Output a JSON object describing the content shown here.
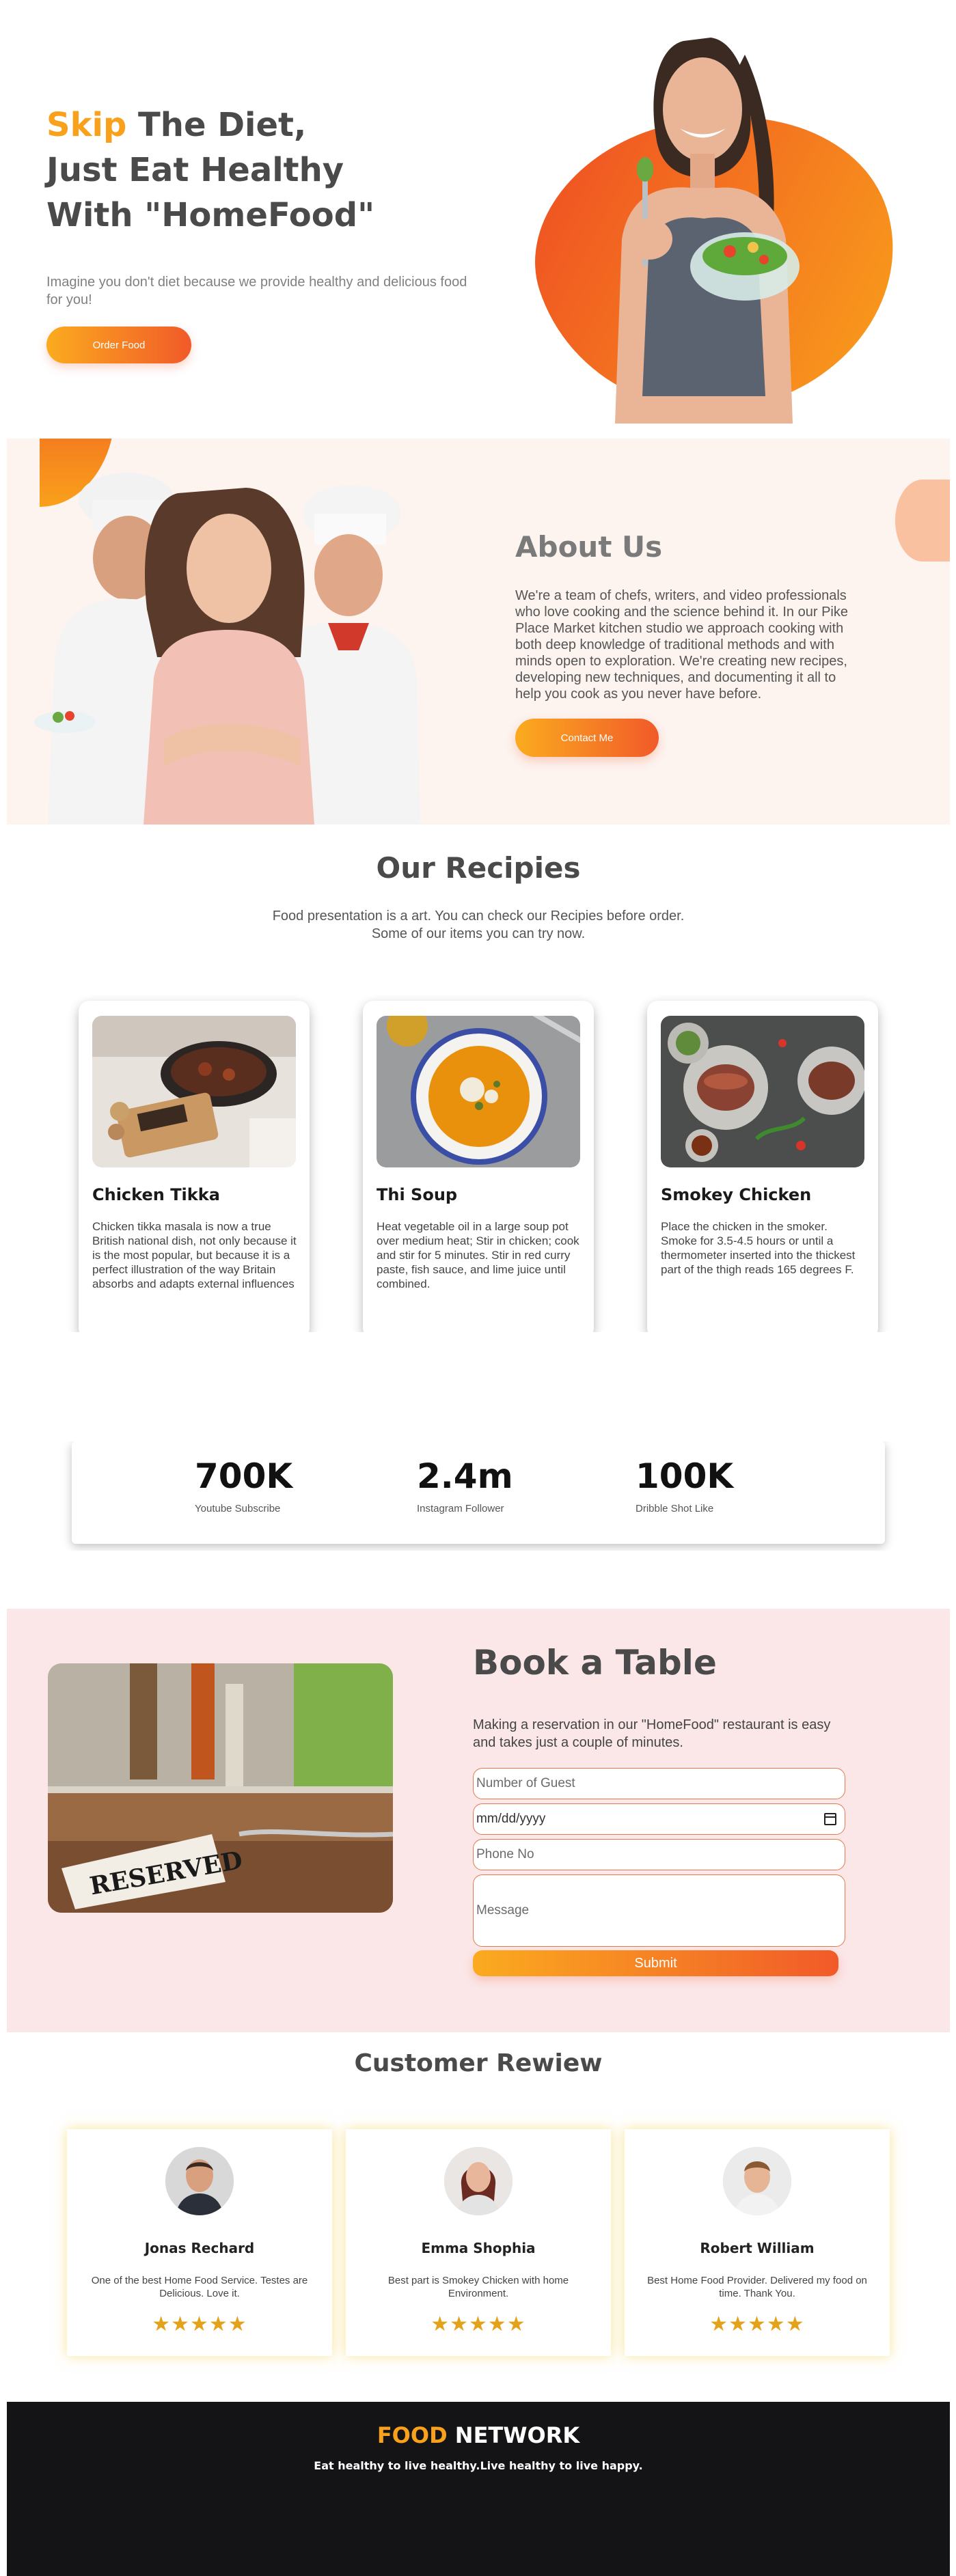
{
  "hero": {
    "title_accent": "Skip",
    "title_rest_1": " The Diet,",
    "title_line_2": "Just Eat Healthy",
    "title_line_3": "With \"HomeFood\"",
    "subtitle": "Imagine you don't diet because we provide healthy and delicious food for you!",
    "cta_label": "Order Food"
  },
  "about": {
    "title": "About Us",
    "text": "We're a team of chefs, writers, and video professionals who love cooking and the science behind it. In our Pike Place Market kitchen studio we approach cooking with both deep knowledge of traditional methods and with minds open to exploration. We're creating new recipes, developing new techniques, and documenting it all to help you cook as you never have before.",
    "cta_label": "Contact Me"
  },
  "recipes": {
    "title": "Our Recipies",
    "subtitle_line_1": "Food presentation is a art. You can check our Recipies before order.",
    "subtitle_line_2": "Some of our items you can try now.",
    "items": [
      {
        "title": "Chicken Tikka",
        "text": "Chicken tikka masala is now a true British national dish, not only because it is the most popular, but because it is a perfect illustration of the way Britain absorbs and adapts external influences"
      },
      {
        "title": "Thi Soup",
        "text": "Heat vegetable oil in a large soup pot over medium heat; Stir in chicken; cook and stir for 5 minutes. Stir in red curry paste, fish sauce, and lime juice until combined."
      },
      {
        "title": "Smokey Chicken",
        "text": "Place the chicken in the smoker. Smoke for 3.5-4.5 hours or until a thermometer inserted into the thickest part of the thigh reads 165 degrees F."
      }
    ]
  },
  "stats": [
    {
      "value": "700K",
      "label": "Youtube Subscribe"
    },
    {
      "value": "2.4m",
      "label": "Instagram Follower"
    },
    {
      "value": "100K",
      "label": "Dribble Shot Like"
    }
  ],
  "book": {
    "image_sign": "RESERVED",
    "title": "Book a Table",
    "subtitle": "Making a reservation in our \"HomeFood\" restaurant is easy and takes just a couple of minutes.",
    "guest_placeholder": "Number of Guest",
    "date_value": "mm/dd/yyyy",
    "phone_placeholder": "Phone No",
    "message_placeholder": "Message",
    "submit_label": "Submit"
  },
  "reviews": {
    "title": "Customer Rewiew",
    "items": [
      {
        "name": "Jonas Rechard",
        "text": "One of the best Home Food Service. Testes are Delicious. Love it.",
        "stars": "★★★★★"
      },
      {
        "name": "Emma Shophia",
        "text": "Best part is Smokey Chicken with home Environment.",
        "stars": "★★★★★"
      },
      {
        "name": "Robert William",
        "text": "Best Home Food Provider. Delivered my food on time. Thank You.",
        "stars": "★★★★★"
      }
    ]
  },
  "footer": {
    "brand_accent": "FOOD",
    "brand_rest": " NETWORK",
    "tagline": "Eat healthy to live healthy.Live healthy to live happy."
  },
  "colors": {
    "accent": "#f9a11b",
    "gradient_start": "#fbab1f",
    "gradient_end": "#f15a29",
    "about_bg": "#fdf3ef",
    "book_bg": "#fbe7e8",
    "footer_bg": "#141416",
    "star": "#e3a21a"
  }
}
